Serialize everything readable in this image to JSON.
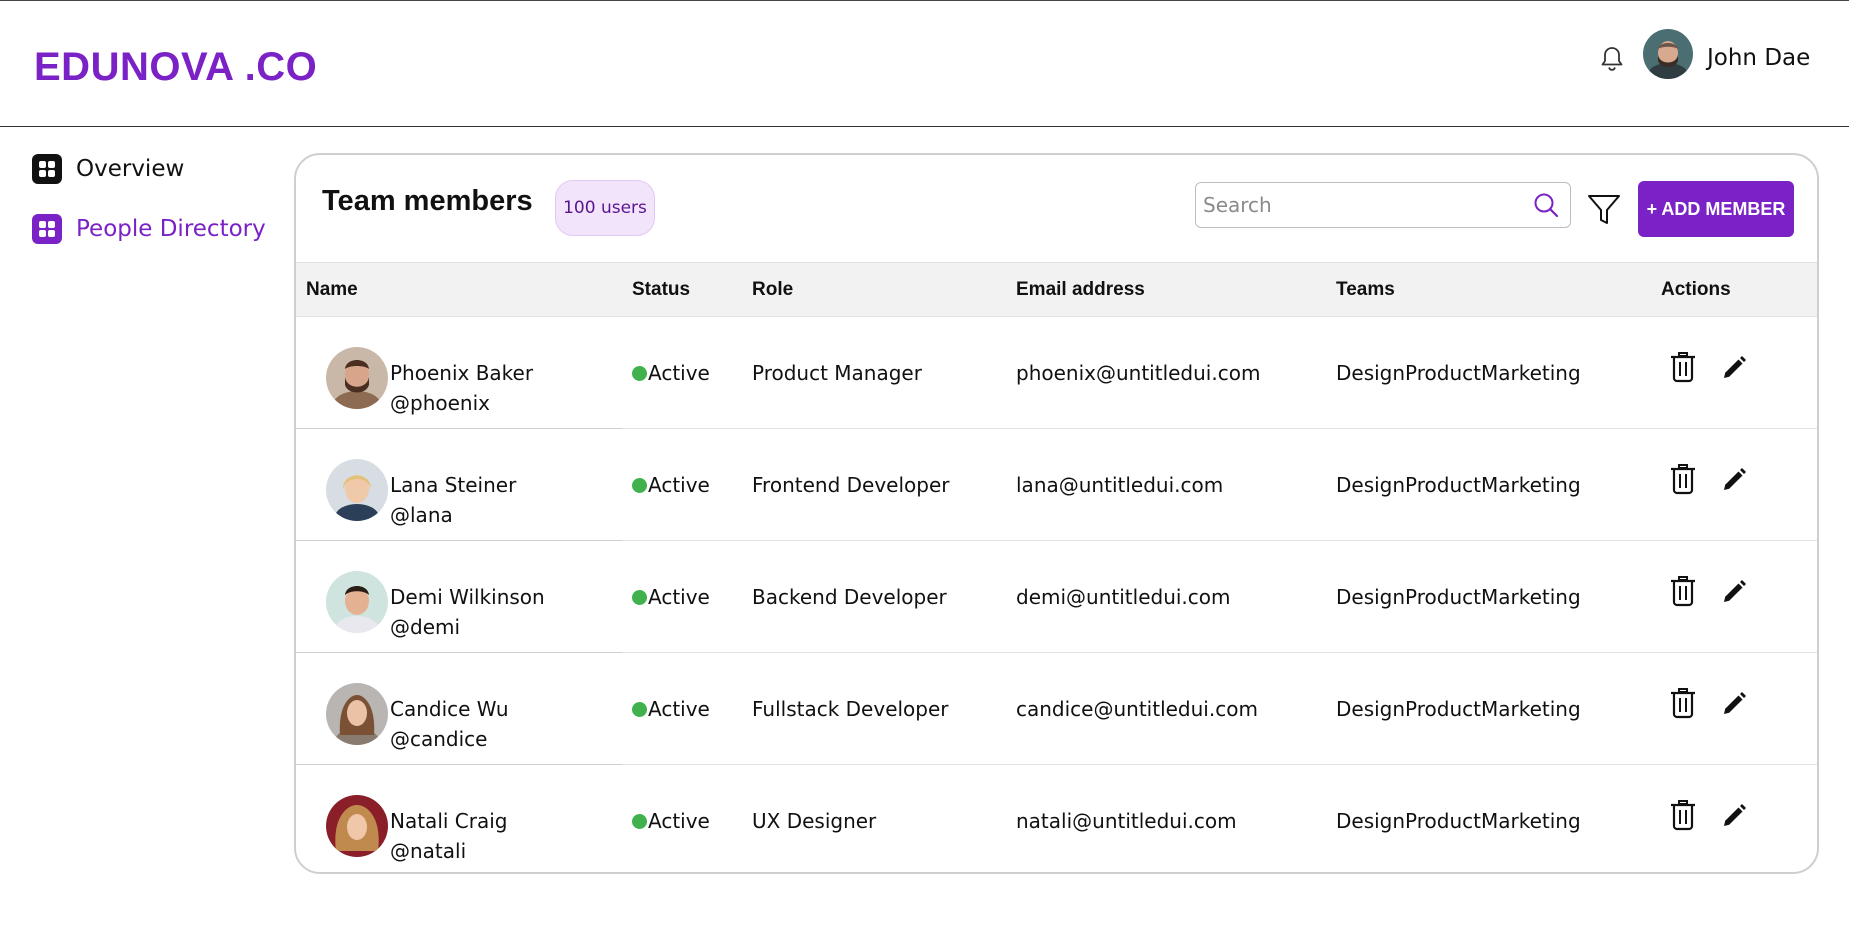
{
  "header": {
    "logo": "EDUNOVA .CO",
    "user_name": "John Dae"
  },
  "sidebar": {
    "items": [
      {
        "label": "Overview",
        "icon": "grid-icon",
        "active": false
      },
      {
        "label": "People Directory",
        "icon": "grid-icon",
        "active": true
      }
    ]
  },
  "main": {
    "title": "Team members",
    "badge": "100 users",
    "search_placeholder": "Search",
    "add_button": "+ ADD MEMBER",
    "columns": [
      "Name",
      "Status",
      "Role",
      "Email address",
      "Teams",
      "Actions"
    ],
    "rows": [
      {
        "name": "Phoenix Baker",
        "handle": "@phoenix",
        "status": "Active",
        "role": "Product Manager",
        "email": "phoenix@untitledui.com",
        "teams": "DesignProductMarketing"
      },
      {
        "name": "Lana Steiner",
        "handle": "@lana",
        "status": "Active",
        "role": "Frontend Developer",
        "email": "lana@untitledui.com",
        "teams": "DesignProductMarketing"
      },
      {
        "name": "Demi Wilkinson",
        "handle": "@demi",
        "status": "Active",
        "role": "Backend Developer",
        "email": "demi@untitledui.com",
        "teams": "DesignProductMarketing"
      },
      {
        "name": "Candice Wu",
        "handle": "@candice",
        "status": "Active",
        "role": "Fullstack Developer",
        "email": "candice@untitledui.com",
        "teams": "DesignProductMarketing"
      },
      {
        "name": "Natali Craig",
        "handle": "@natali",
        "status": "Active",
        "role": "UX Designer",
        "email": "natali@untitledui.com",
        "teams": "DesignProductMarketing"
      }
    ]
  },
  "colors": {
    "brand": "#7a22c6",
    "status_active": "#3fb24e",
    "badge_bg": "#f1e4fb"
  }
}
